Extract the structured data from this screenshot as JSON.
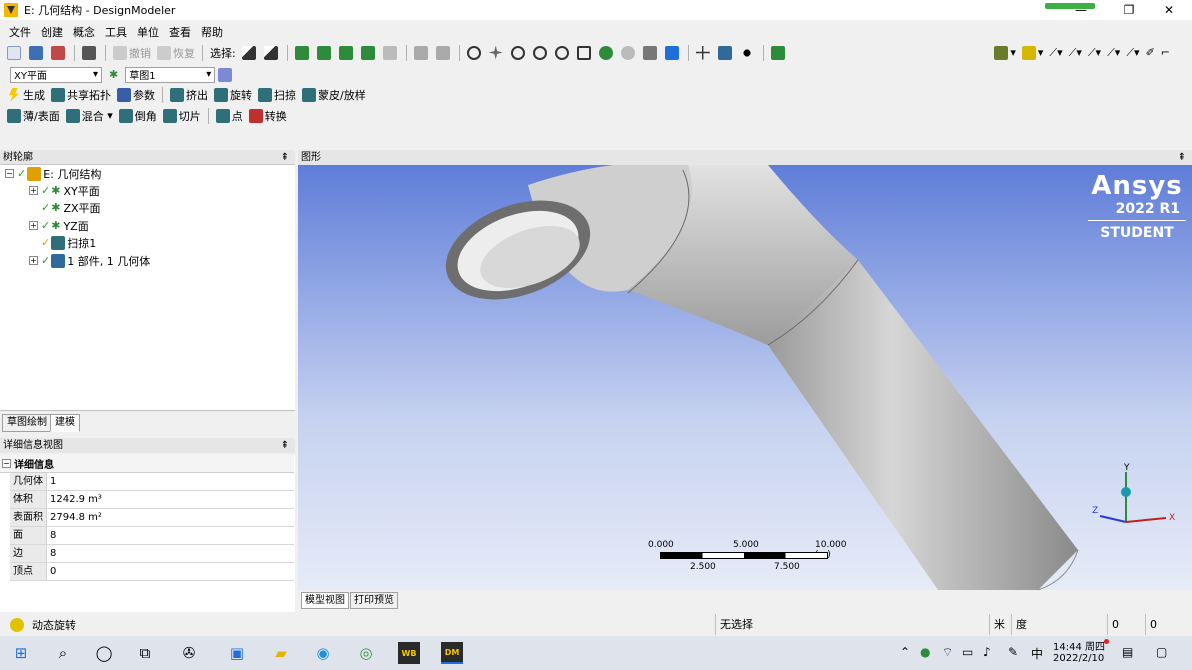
{
  "window": {
    "title": "E: 几何结构 - DesignModeler",
    "minimize": "—",
    "restore": "❐",
    "close": "✕"
  },
  "menu": [
    "文件",
    "创建",
    "概念",
    "工具",
    "单位",
    "查看",
    "帮助"
  ],
  "toolbar1": {
    "undo_label": "撤销",
    "redo_label": "恢复",
    "select_label": "选择:"
  },
  "toolbar2": {
    "plane_combo": "XY平面",
    "sketch_combo": "草图1"
  },
  "toolbar3": {
    "generate": "生成",
    "share_topology": "共享拓扑",
    "parameters": "参数",
    "extrude": "挤出",
    "revolve": "旋转",
    "sweep": "扫掠",
    "skin_loft": "蒙皮/放样"
  },
  "toolbar4": {
    "thin_surface": "薄/表面",
    "blend": "混合",
    "chamfer": "倒角",
    "slice": "切片",
    "point": "点",
    "conversion": "转换"
  },
  "tree": {
    "header": "树轮廓",
    "pin": "⇞",
    "nodes": [
      {
        "label": "E: 几何结构",
        "level": 0,
        "expander": "−"
      },
      {
        "label": "XY平面",
        "level": 1,
        "expander": "+"
      },
      {
        "label": "ZX平面",
        "level": 1,
        "expander": ""
      },
      {
        "label": "YZ面",
        "level": 1,
        "expander": "+"
      },
      {
        "label": "扫掠1",
        "level": 1,
        "expander": ""
      },
      {
        "label": "1 部件, 1 几何体",
        "level": 1,
        "expander": "+"
      }
    ],
    "tabs": [
      "草图绘制",
      "建模"
    ]
  },
  "details": {
    "header": "详细信息视图",
    "pin": "⇞",
    "section": "详细信息",
    "rows": [
      {
        "key": "几何体",
        "value": "1"
      },
      {
        "key": "体积",
        "value": "1242.9 m³"
      },
      {
        "key": "表面积",
        "value": "2794.8 m²"
      },
      {
        "key": "面",
        "value": "8"
      },
      {
        "key": "边",
        "value": "8"
      },
      {
        "key": "顶点",
        "value": "0"
      }
    ]
  },
  "graphics": {
    "header": "图形",
    "pin": "⇞",
    "brand": {
      "name": "Ansys",
      "version": "2022 R1",
      "edition": "STUDENT"
    },
    "scale": {
      "top": [
        "0.000",
        "5.000",
        "10.000 (m)"
      ],
      "bottom": [
        "2.500",
        "7.500"
      ]
    },
    "axes": {
      "x": "X",
      "y": "Y",
      "z": "Z"
    },
    "tabs": [
      "模型视图",
      "打印预览"
    ]
  },
  "status": {
    "message": "动态旋转",
    "selection": "无选择",
    "units_length": "米",
    "units_angle": "度",
    "field1": "0",
    "field2": "0"
  },
  "taskbar": {
    "time": "14:44 周四",
    "date": "2022/2/10",
    "ime": "中",
    "wb_label": "WB",
    "dm_label": "DM"
  },
  "colors": {
    "accent": "#1e6fd9",
    "viewport_top": "#5f7dd9",
    "viewport_bottom": "#e6ebf7",
    "pipe": "#bdbdbd"
  }
}
